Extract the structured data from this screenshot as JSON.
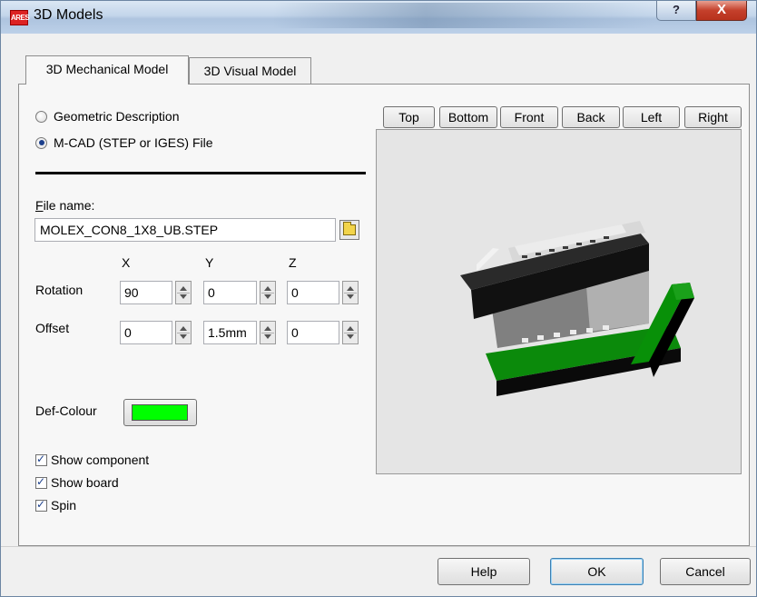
{
  "window": {
    "title": "3D Models",
    "app_icon": "ARES",
    "help_glyph": "?",
    "close_glyph": "X"
  },
  "tabs": [
    {
      "label": "3D Mechanical Model",
      "active": true
    },
    {
      "label": "3D Visual Model",
      "active": false
    }
  ],
  "source": {
    "options": [
      {
        "label": "Geometric Description",
        "checked": false
      },
      {
        "label": "M-CAD (STEP or IGES) File",
        "checked": true
      }
    ]
  },
  "file": {
    "label": "File name:",
    "value": "MOLEX_CON8_1X8_UB.STEP",
    "browse_icon": "folder-icon"
  },
  "transform": {
    "axes": [
      "X",
      "Y",
      "Z"
    ],
    "rotation": {
      "label": "Rotation",
      "x": "90",
      "y": "0",
      "z": "0"
    },
    "offset": {
      "label": "Offset",
      "x": "0",
      "y": "1.5mm",
      "z": "0"
    }
  },
  "def_colour": {
    "label": "Def-Colour",
    "color": "#00ff00"
  },
  "checks": [
    {
      "label": "Show component",
      "checked": true
    },
    {
      "label": "Show board",
      "checked": true
    },
    {
      "label": "Spin",
      "checked": true
    }
  ],
  "views": [
    "Top",
    "Bottom",
    "Front",
    "Back",
    "Left",
    "Right"
  ],
  "buttons": {
    "help": "Help",
    "ok": "OK",
    "cancel": "Cancel"
  }
}
